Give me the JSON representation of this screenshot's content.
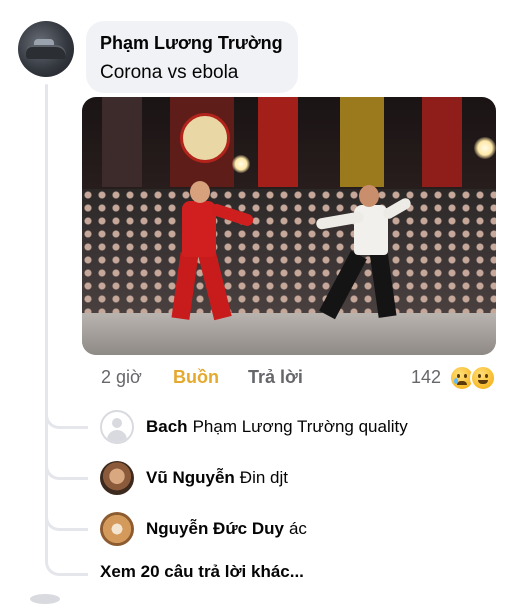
{
  "comment": {
    "author": "Phạm Lương Trường",
    "text": "Corona vs ebola",
    "time": "2 giờ",
    "reaction_label": "Buồn",
    "reply_label": "Trả lời",
    "reaction_count": "142",
    "reaction_icons": [
      "sad-emoji-icon",
      "haha-emoji-icon"
    ],
    "reaction_color": "#e6a92f"
  },
  "replies": [
    {
      "name": "Bach",
      "text": "Phạm Lương Trường quality"
    },
    {
      "name": "Vũ Nguyễn",
      "text": "Đin djt"
    },
    {
      "name": "Nguyễn Đức Duy",
      "text": "ác"
    }
  ],
  "more_replies_label": "Xem 20 câu trả lời khác..."
}
